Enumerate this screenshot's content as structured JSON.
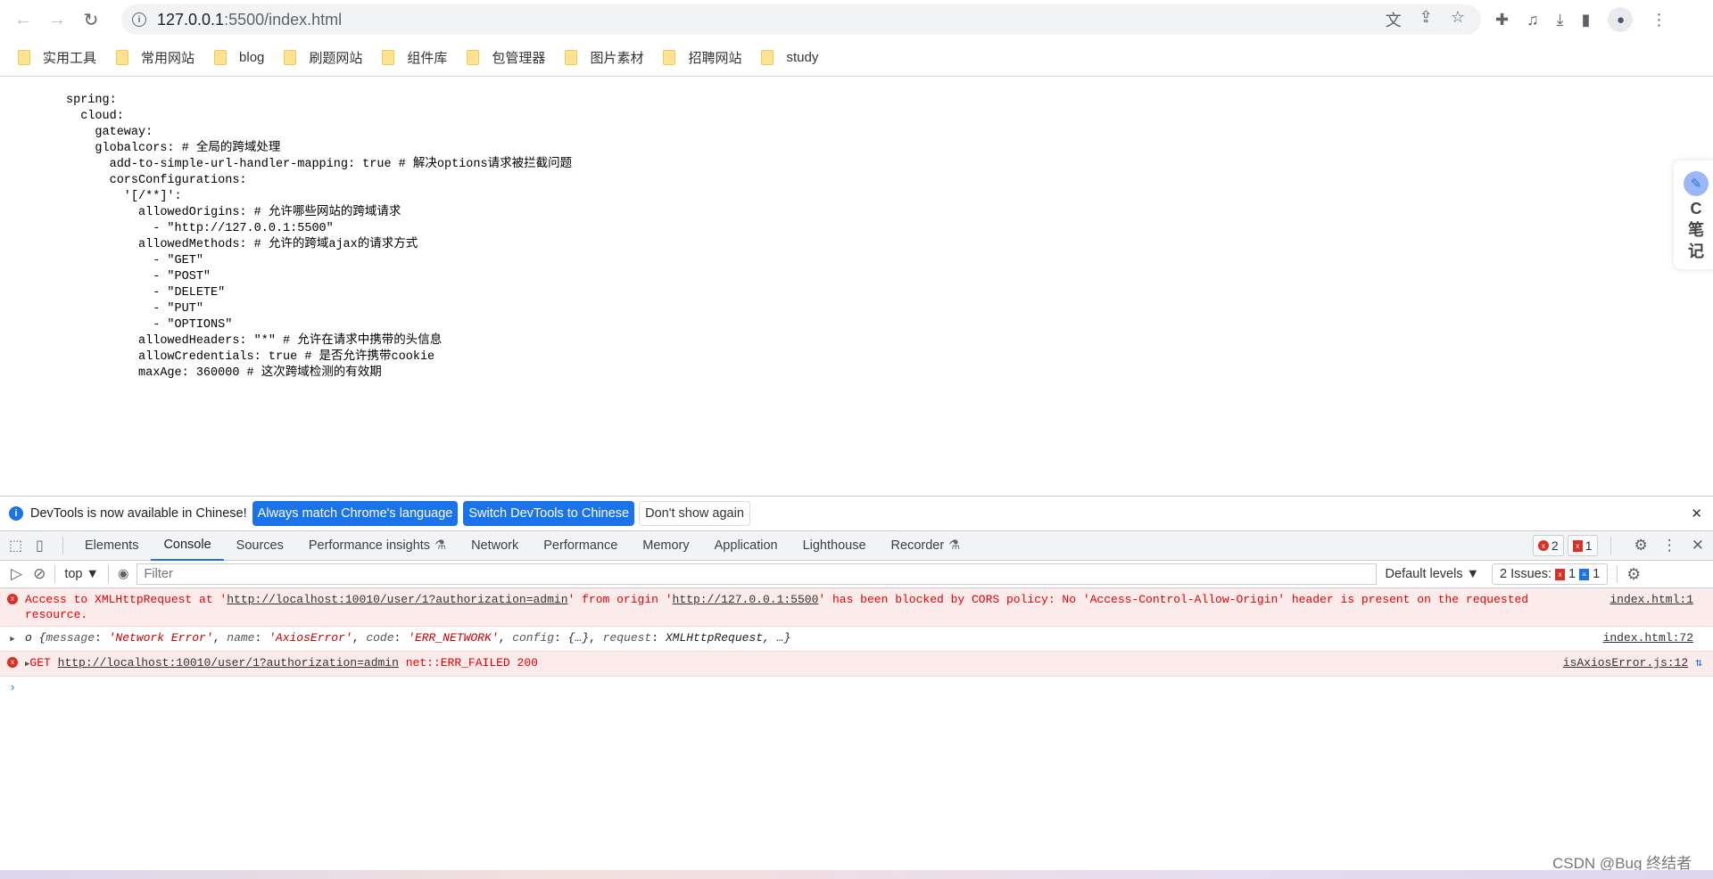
{
  "browser": {
    "url_host": "127.0.0.1",
    "url_rest": ":5500/index.html"
  },
  "bookmarks": [
    "实用工具",
    "常用网站",
    "blog",
    "刷题网站",
    "组件库",
    "包管理器",
    "图片素材",
    "招聘网站",
    "study"
  ],
  "code_lines": [
    "spring:",
    "  cloud:",
    "    gateway:",
    "    globalcors: # 全局的跨域处理",
    "      add-to-simple-url-handler-mapping: true # 解决options请求被拦截问题",
    "      corsConfigurations:",
    "        '[/**]':",
    "          allowedOrigins: # 允许哪些网站的跨域请求",
    "            - \"http://127.0.0.1:5500\"",
    "          allowedMethods: # 允许的跨域ajax的请求方式",
    "            - \"GET\"",
    "            - \"POST\"",
    "            - \"DELETE\"",
    "            - \"PUT\"",
    "            - \"OPTIONS\"",
    "          allowedHeaders: \"*\" # 允许在请求中携带的头信息",
    "          allowCredentials: true # 是否允许携带cookie",
    "          maxAge: 360000 # 这次跨域检测的有效期"
  ],
  "cnote": {
    "letter": "C",
    "l1": "笔",
    "l2": "记"
  },
  "devtools": {
    "banner": {
      "text": "DevTools is now available in Chinese!",
      "btn1": "Always match Chrome's language",
      "btn2": "Switch DevTools to Chinese",
      "btn3": "Don't show again"
    },
    "tabs": [
      "Elements",
      "Console",
      "Sources",
      "Performance insights",
      "Network",
      "Performance",
      "Memory",
      "Application",
      "Lighthouse",
      "Recorder"
    ],
    "active_tab": "Console",
    "error_count": "2",
    "issue_count": "1",
    "context": "top",
    "filter_placeholder": "Filter",
    "levels": "Default levels",
    "issues": {
      "label": "2 Issues:",
      "errors": "1",
      "info": "1"
    },
    "messages": {
      "m1": {
        "a": "Access to XMLHttpRequest at '",
        "url1": "http://localhost:10010/user/1?authorization=admin",
        "b": "' from origin '",
        "url2": "http://127.0.0.1:5500",
        "c": "' has been blocked by CORS policy: No 'Access-Control-Allow-Origin' header is present on the requested resource.",
        "src": "index.html:1"
      },
      "m2": {
        "o": "o {",
        "k1": "message",
        "v1": "'Network Error'",
        "k2": "name",
        "v2": "'AxiosError'",
        "k3": "code",
        "v3": "'ERR_NETWORK'",
        "k4": "config",
        "v4": "{…}",
        "k5": "request",
        "v5": "XMLHttpRequest, …}",
        "src": "index.html:72"
      },
      "m3": {
        "method": "GET",
        "url": "http://localhost:10010/user/1?authorization=admin",
        "status": "net::ERR_FAILED 200",
        "src": "isAxiosError.js:12"
      }
    }
  },
  "watermark": "CSDN @Bug 终结者"
}
